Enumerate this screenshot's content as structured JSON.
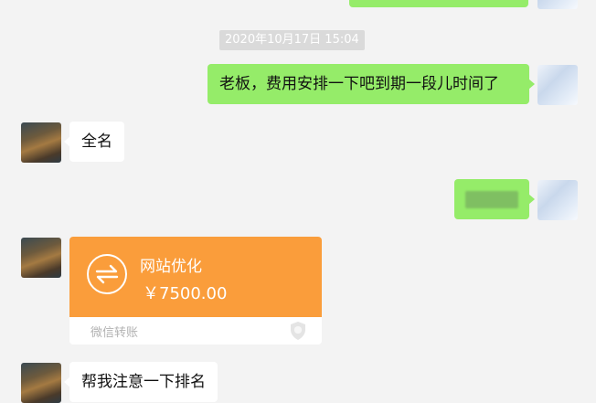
{
  "chat": {
    "timestamp": "2020年10月17日 15:04",
    "messages": [
      {
        "sender": "self",
        "text": "老板，费用安排一下吧到期一段儿时间了"
      },
      {
        "sender": "other",
        "text": "全名"
      },
      {
        "sender": "self",
        "text": ""
      },
      {
        "sender": "other",
        "type": "transfer",
        "title": "网站优化",
        "amount": "￥7500.00",
        "footer": "微信转账"
      },
      {
        "sender": "other",
        "text": "帮我注意一下排名"
      }
    ]
  },
  "colors": {
    "self_bubble": "#95ec69",
    "other_bubble": "#ffffff",
    "transfer_orange": "#fa9d3b",
    "background": "#f3f3f3"
  },
  "icons": {
    "transfer": "transfer-arrows-icon",
    "shield": "shield-icon"
  }
}
